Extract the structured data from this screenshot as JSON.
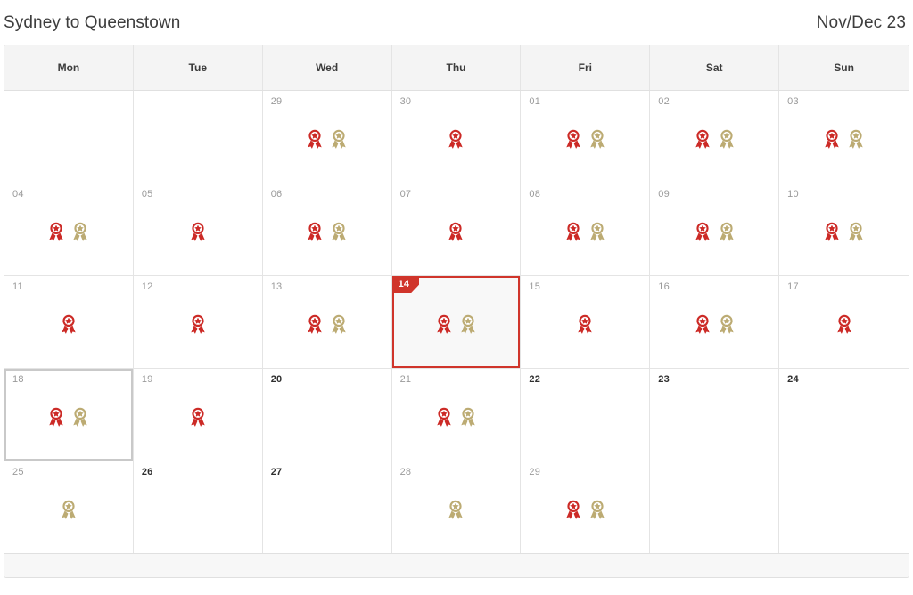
{
  "header": {
    "route_title": "Sydney to Queenstown",
    "month_label": "Nov/Dec 23"
  },
  "colors": {
    "award_red": "#cc2a26",
    "award_gold": "#bcab73",
    "selected_border": "#d0352b",
    "hover_border": "#c9c9c9",
    "grid_line": "#e4e4e4",
    "header_bg": "#f4f4f4"
  },
  "weekdays": [
    {
      "label": "Mon"
    },
    {
      "label": "Tue"
    },
    {
      "label": "Wed"
    },
    {
      "label": "Thu"
    },
    {
      "label": "Fri"
    },
    {
      "label": "Sat"
    },
    {
      "label": "Sun"
    }
  ],
  "weeks": [
    {
      "days": [
        {
          "date": "",
          "empty": true,
          "awards": [],
          "state": "normal",
          "strong": false
        },
        {
          "date": "",
          "empty": true,
          "awards": [],
          "state": "normal",
          "strong": false
        },
        {
          "date": "29",
          "empty": false,
          "awards": [
            "red",
            "gold"
          ],
          "state": "normal",
          "strong": false
        },
        {
          "date": "30",
          "empty": false,
          "awards": [
            "red"
          ],
          "state": "normal",
          "strong": false
        },
        {
          "date": "01",
          "empty": false,
          "awards": [
            "red",
            "gold"
          ],
          "state": "normal",
          "strong": false
        },
        {
          "date": "02",
          "empty": false,
          "awards": [
            "red",
            "gold"
          ],
          "state": "normal",
          "strong": false
        },
        {
          "date": "03",
          "empty": false,
          "awards": [
            "red",
            "gold"
          ],
          "state": "normal",
          "strong": false
        }
      ]
    },
    {
      "days": [
        {
          "date": "04",
          "empty": false,
          "awards": [
            "red",
            "gold"
          ],
          "state": "normal",
          "strong": false
        },
        {
          "date": "05",
          "empty": false,
          "awards": [
            "red"
          ],
          "state": "normal",
          "strong": false
        },
        {
          "date": "06",
          "empty": false,
          "awards": [
            "red",
            "gold"
          ],
          "state": "normal",
          "strong": false
        },
        {
          "date": "07",
          "empty": false,
          "awards": [
            "red"
          ],
          "state": "normal",
          "strong": false
        },
        {
          "date": "08",
          "empty": false,
          "awards": [
            "red",
            "gold"
          ],
          "state": "normal",
          "strong": false
        },
        {
          "date": "09",
          "empty": false,
          "awards": [
            "red",
            "gold"
          ],
          "state": "normal",
          "strong": false
        },
        {
          "date": "10",
          "empty": false,
          "awards": [
            "red",
            "gold"
          ],
          "state": "normal",
          "strong": false
        }
      ]
    },
    {
      "days": [
        {
          "date": "11",
          "empty": false,
          "awards": [
            "red"
          ],
          "state": "normal",
          "strong": false
        },
        {
          "date": "12",
          "empty": false,
          "awards": [
            "red"
          ],
          "state": "normal",
          "strong": false
        },
        {
          "date": "13",
          "empty": false,
          "awards": [
            "red",
            "gold"
          ],
          "state": "normal",
          "strong": false
        },
        {
          "date": "14",
          "empty": false,
          "awards": [
            "red",
            "gold"
          ],
          "state": "selected",
          "strong": false
        },
        {
          "date": "15",
          "empty": false,
          "awards": [
            "red"
          ],
          "state": "normal",
          "strong": false
        },
        {
          "date": "16",
          "empty": false,
          "awards": [
            "red",
            "gold"
          ],
          "state": "normal",
          "strong": false
        },
        {
          "date": "17",
          "empty": false,
          "awards": [
            "red"
          ],
          "state": "normal",
          "strong": false
        }
      ]
    },
    {
      "days": [
        {
          "date": "18",
          "empty": false,
          "awards": [
            "red",
            "gold"
          ],
          "state": "hovered",
          "strong": false
        },
        {
          "date": "19",
          "empty": false,
          "awards": [
            "red"
          ],
          "state": "normal",
          "strong": false
        },
        {
          "date": "20",
          "empty": false,
          "awards": [],
          "state": "normal",
          "strong": true
        },
        {
          "date": "21",
          "empty": false,
          "awards": [
            "red",
            "gold"
          ],
          "state": "normal",
          "strong": false
        },
        {
          "date": "22",
          "empty": false,
          "awards": [],
          "state": "normal",
          "strong": true
        },
        {
          "date": "23",
          "empty": false,
          "awards": [],
          "state": "normal",
          "strong": true
        },
        {
          "date": "24",
          "empty": false,
          "awards": [],
          "state": "normal",
          "strong": true
        }
      ]
    },
    {
      "days": [
        {
          "date": "25",
          "empty": false,
          "awards": [
            "gold"
          ],
          "state": "normal",
          "strong": false
        },
        {
          "date": "26",
          "empty": false,
          "awards": [],
          "state": "normal",
          "strong": true
        },
        {
          "date": "27",
          "empty": false,
          "awards": [],
          "state": "normal",
          "strong": true
        },
        {
          "date": "28",
          "empty": false,
          "awards": [
            "gold"
          ],
          "state": "normal",
          "strong": false
        },
        {
          "date": "29",
          "empty": false,
          "awards": [
            "red",
            "gold"
          ],
          "state": "normal",
          "strong": false
        },
        {
          "date": "",
          "empty": true,
          "awards": [],
          "state": "normal",
          "strong": false
        },
        {
          "date": "",
          "empty": true,
          "awards": [],
          "state": "normal",
          "strong": false
        }
      ]
    }
  ]
}
